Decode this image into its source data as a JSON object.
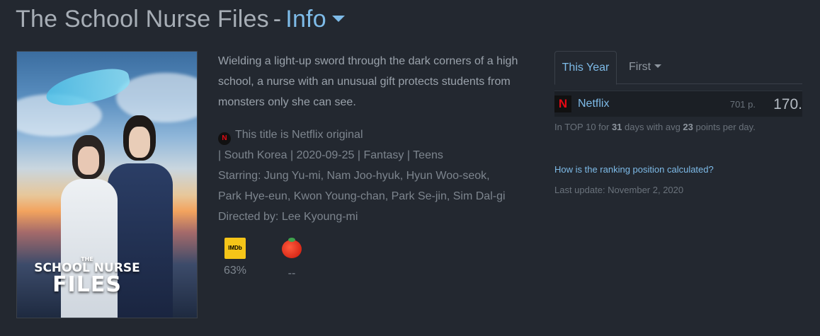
{
  "header": {
    "title": "The School Nurse Files",
    "separator": "-",
    "section": "Info"
  },
  "poster": {
    "title_small": "THE",
    "title_line1": "SCHOOL NURSE",
    "title_line2": "FILES"
  },
  "description": "Wielding a light-up sword through the dark corners of a high school, a nurse with an unusual gift protects students from monsters only she can see.",
  "meta": {
    "netflix_badge": "N",
    "original": "This title is Netflix original",
    "details": "| South Korea | 2020-09-25 | Fantasy | Teens",
    "starring_1": "Starring: Jung Yu-mi, Nam Joo-hyuk, Hyun Woo-seok,",
    "starring_2": "Park Hye-eun, Kwon Young-chan, Park Se-jin, Sim Dal-gi",
    "directed": "Directed by: Lee Kyoung-mi"
  },
  "scores": {
    "imdb_label": "IMDb",
    "imdb_value": "63%",
    "rt_value": "--"
  },
  "ranking": {
    "tabs": {
      "active": "This Year",
      "other": "First"
    },
    "service_logo": "N",
    "service": "Netflix",
    "points": "701 p.",
    "rank": "170.",
    "top10_prefix": "In TOP 10 for ",
    "top10_days": "31",
    "top10_mid": " days with avg ",
    "top10_avg": "23",
    "top10_suffix": " points per day.",
    "how_link": "How is the ranking position calculated?",
    "last_update": "Last update: November 2, 2020"
  },
  "colors": {
    "background": "#232830",
    "accent": "#7ebbe8",
    "netflix_red": "#e50914",
    "imdb_yellow": "#f5c518"
  }
}
